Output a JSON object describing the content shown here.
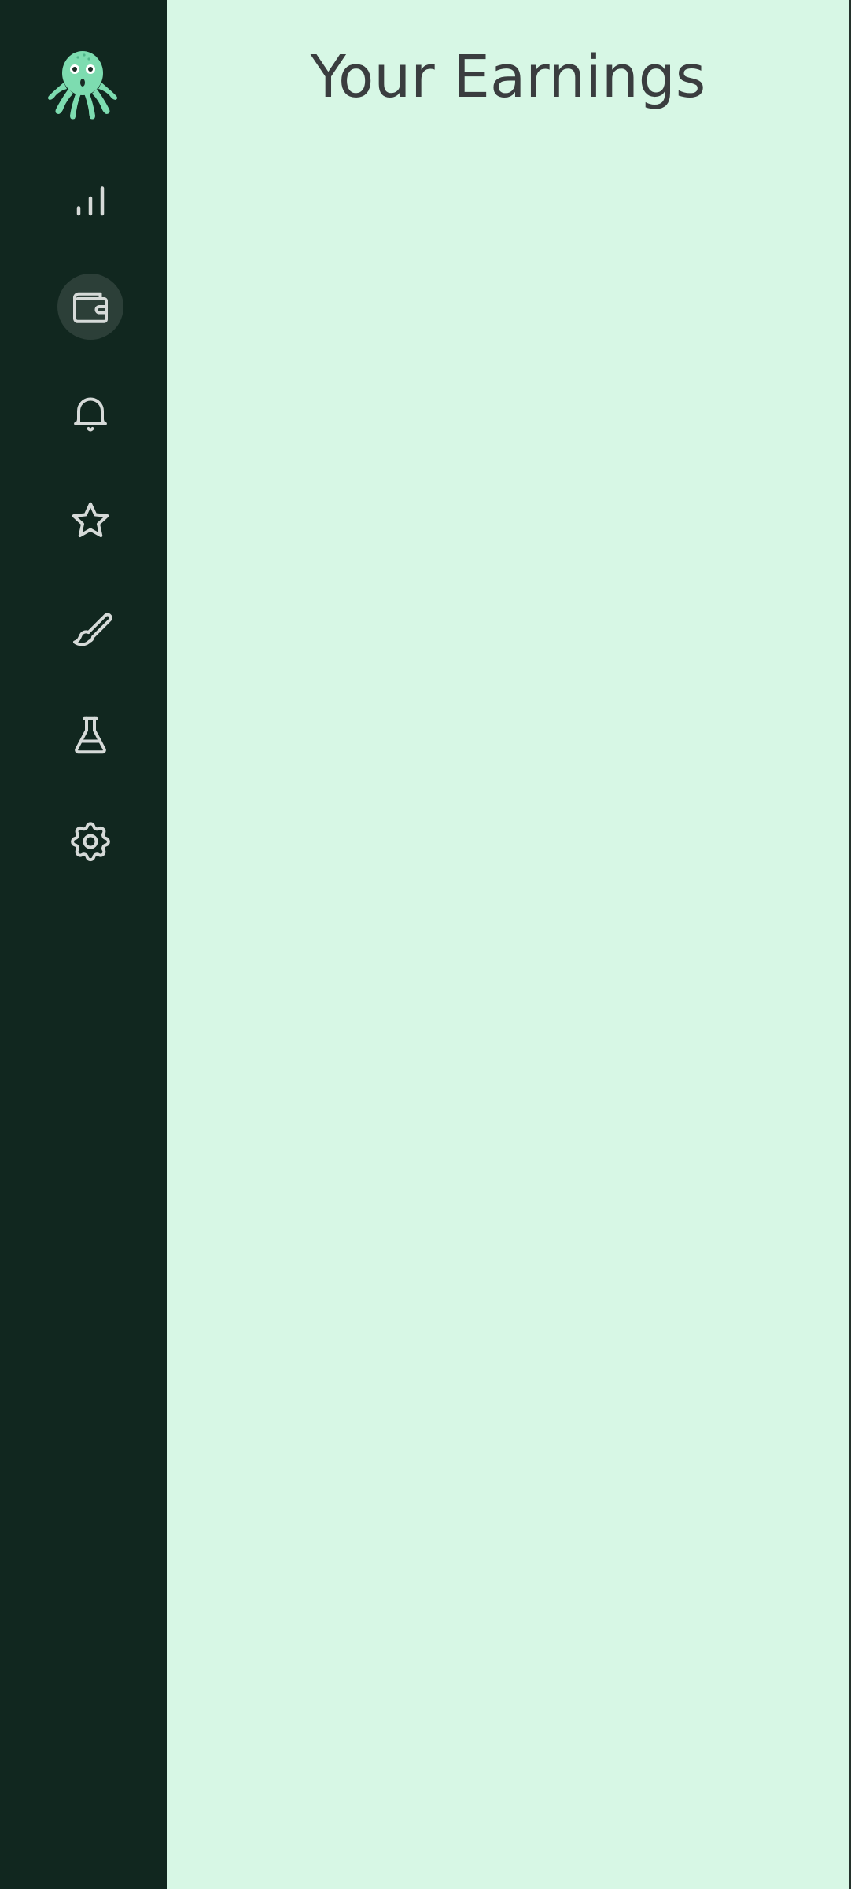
{
  "app": {
    "logo_icon": "octopus-logo-icon",
    "colors": {
      "sidebar_bg": "#11271f",
      "main_bg": "#d7f7e5",
      "active_nav_bg": "#2c3f38",
      "icon_color": "#d6dad8",
      "logo_color": "#7ddcb0",
      "title_color": "#3a3d3f"
    }
  },
  "sidebar": {
    "items": [
      {
        "id": "stats",
        "icon": "bar-chart-icon",
        "active": false
      },
      {
        "id": "wallet",
        "icon": "wallet-icon",
        "active": true
      },
      {
        "id": "notifications",
        "icon": "bell-icon",
        "active": false
      },
      {
        "id": "favorites",
        "icon": "star-icon",
        "active": false
      },
      {
        "id": "customize",
        "icon": "paintbrush-icon",
        "active": false
      },
      {
        "id": "labs",
        "icon": "flask-icon",
        "active": false
      },
      {
        "id": "settings",
        "icon": "gear-icon",
        "active": false
      }
    ]
  },
  "main": {
    "title": "Your Earnings"
  }
}
